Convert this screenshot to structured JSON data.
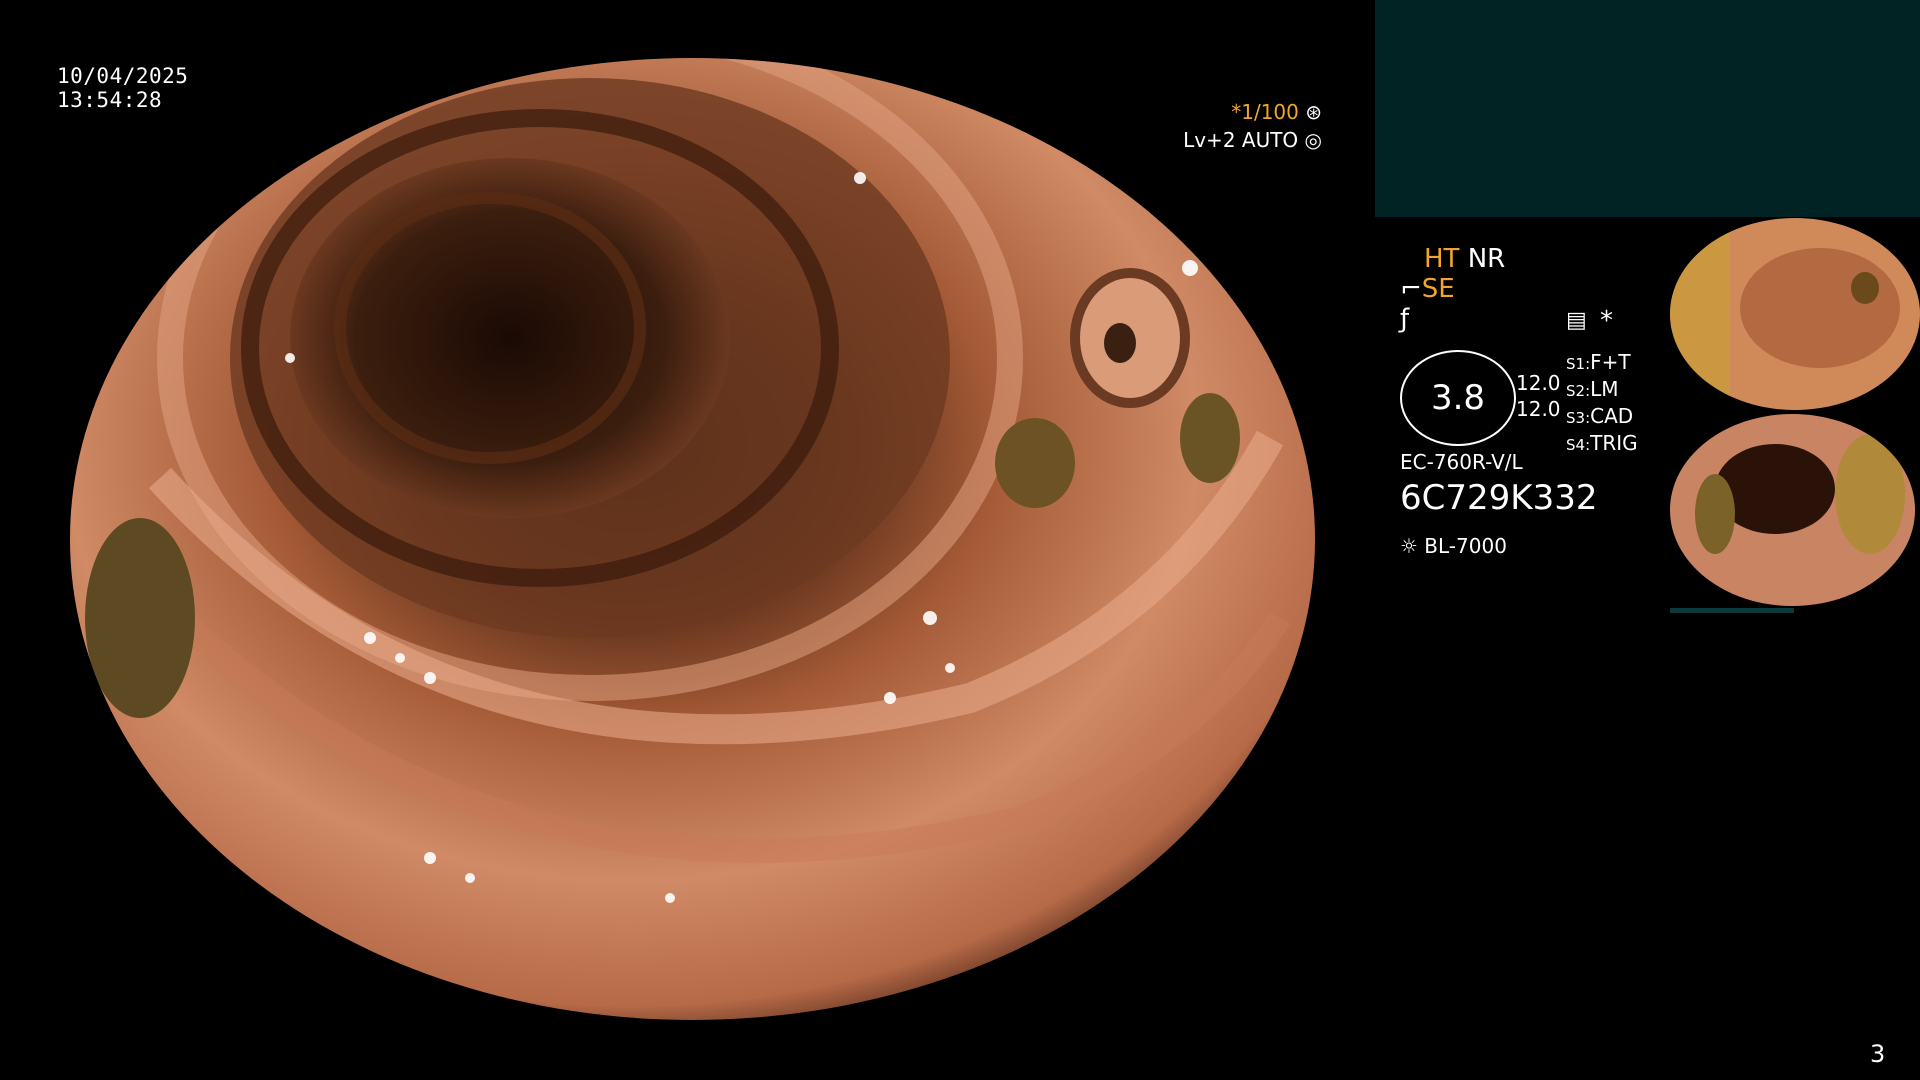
{
  "overlay": {
    "date": "10/04/2025",
    "time": "13:54:28",
    "shutter": "*1/100",
    "level": "Lv+2 AUTO"
  },
  "panel": {
    "ht": "HT",
    "nr": "NR",
    "se": "SE",
    "enhance_value": "3.8",
    "value_a": "12.0",
    "value_b": "12.0",
    "s1": "S1:",
    "s1_val": "F+T",
    "s2": "S2:",
    "s2_val": "LM",
    "s3": "S3:",
    "s3_val": "CAD",
    "s4": "S4:",
    "s4_val": "TRIG",
    "scope_model": "EC-760R-V/L",
    "serial": "6C729K332",
    "light_source": "BL-7000",
    "star": "*"
  },
  "page_number": "3",
  "colors": {
    "accent": "#f2a52b",
    "preview_bg": "#022323",
    "tissue": "#c98563"
  },
  "icons": [
    "shutter-icon",
    "auto-icon",
    "scope-icon",
    "enhance-icon",
    "menu-icon",
    "light-icon"
  ]
}
